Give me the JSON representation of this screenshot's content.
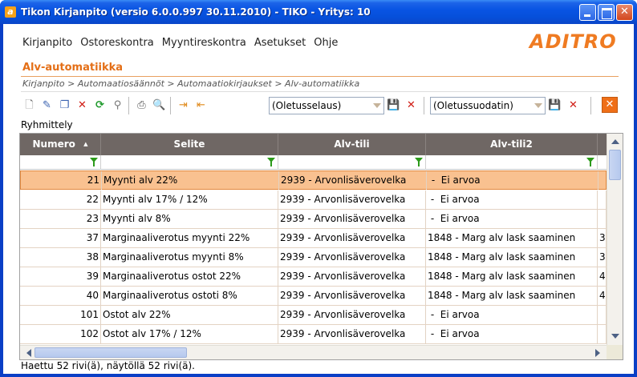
{
  "window": {
    "title": "Tikon Kirjanpito (versio 6.0.0.997 30.11.2010) - TIKO - Yritys: 10",
    "app_icon": "tiko-app-icon"
  },
  "menu": {
    "items": [
      "Kirjanpito",
      "Ostoreskontra",
      "Myyntireskontra",
      "Asetukset",
      "Ohje"
    ]
  },
  "logo": {
    "text": "ADITRO",
    "color": "#ef7b22"
  },
  "page": {
    "title": "Alv-automatiikka",
    "breadcrumb": "Kirjanpito > Automaatiosäännöt > Automaatiokirjaukset > Alv-automatiikka"
  },
  "toolbar": {
    "view_select": "(Oletusselaus)",
    "filter_select": "(Oletussuodatin)",
    "close_label": "✕"
  },
  "grouping_label": "Ryhmittely",
  "grid": {
    "columns": [
      "Numero",
      "Selite",
      "Alv-tili",
      "Alv-tili2"
    ],
    "sort_indicator": "▲",
    "rows": [
      {
        "numero": "21",
        "selite": "Myynti alv 22%",
        "alv_tili": "2939 - Arvonlisäverovelka",
        "alv_tili2": " -  Ei arvoa",
        "extra": "",
        "selected": true
      },
      {
        "numero": "22",
        "selite": "Myynti alv 17% / 12%",
        "alv_tili": "2939 - Arvonlisäverovelka",
        "alv_tili2": " -  Ei arvoa",
        "extra": ""
      },
      {
        "numero": "23",
        "selite": "Myynti alv 8%",
        "alv_tili": "2939 - Arvonlisäverovelka",
        "alv_tili2": " -  Ei arvoa",
        "extra": ""
      },
      {
        "numero": "37",
        "selite": "Marginaaliverotus myynti 22%",
        "alv_tili": "2939 - Arvonlisäverovelka",
        "alv_tili2": "1848 - Marg alv lask saaminen",
        "extra": "3"
      },
      {
        "numero": "38",
        "selite": "Marginaaliverotus myynti 8%",
        "alv_tili": "2939 - Arvonlisäverovelka",
        "alv_tili2": "1848 - Marg alv lask saaminen",
        "extra": "3"
      },
      {
        "numero": "39",
        "selite": "Marginaaliverotus ostot 22%",
        "alv_tili": "2939 - Arvonlisäverovelka",
        "alv_tili2": "1848 - Marg alv lask saaminen",
        "extra": "4"
      },
      {
        "numero": "40",
        "selite": "Marginaaliverotus ostoti 8%",
        "alv_tili": "2939 - Arvonlisäverovelka",
        "alv_tili2": "1848 - Marg alv lask saaminen",
        "extra": "4"
      },
      {
        "numero": "101",
        "selite": "Ostot alv 22%",
        "alv_tili": "2939 - Arvonlisäverovelka",
        "alv_tili2": " -  Ei arvoa",
        "extra": ""
      },
      {
        "numero": "102",
        "selite": "Ostot alv 17% / 12%",
        "alv_tili": "2939 - Arvonlisäverovelka",
        "alv_tili2": " -  Ei arvoa",
        "extra": ""
      }
    ]
  },
  "status": "Haettu 52 rivi(ä), näytöllä 52 rivi(ä).",
  "colors": {
    "accent": "#e46f17",
    "header_bg": "#6f6764",
    "selected_row": "#f9c190"
  }
}
